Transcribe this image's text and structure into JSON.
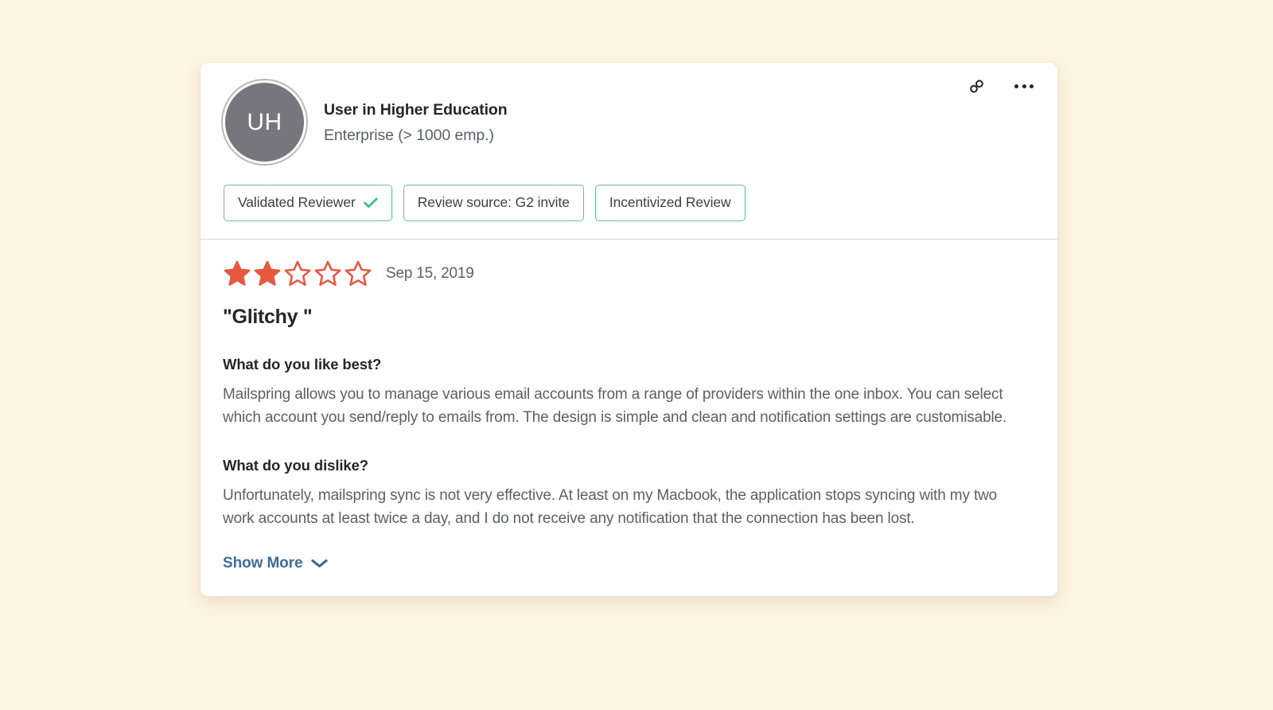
{
  "theme": {
    "page_background": "#fdf4e1",
    "card_background": "#ffffff",
    "badge_border": "#62c29a",
    "star_filled": "#e8573f",
    "star_empty_outline": "#e8573f",
    "link_color": "#3d6d95",
    "avatar_background": "#76767c",
    "check_color": "#3fc28a",
    "divider": "#d6d6d8"
  },
  "review": {
    "reviewer": {
      "avatar_initials": "UH",
      "name": "User in Higher Education",
      "company_size": "Enterprise (> 1000 emp.)"
    },
    "header_actions": {
      "share_link_label": "link-icon",
      "more_options_label": "..."
    },
    "badges": [
      {
        "label": "Validated Reviewer",
        "has_check": true
      },
      {
        "label": "Review source: G2 invite",
        "has_check": false
      },
      {
        "label": "Incentivized Review",
        "has_check": false
      }
    ],
    "rating": {
      "value": 2,
      "max": 5,
      "date": "Sep 15, 2019"
    },
    "title": "\"Glitchy \"",
    "sections": [
      {
        "question": "What do you like best?",
        "answer": "Mailspring allows you to manage various email accounts from a range of providers within the one inbox. You can select which account you send/reply to emails from. The design is simple and clean and notification settings are customisable."
      },
      {
        "question": "What do you dislike?",
        "answer": "Unfortunately, mailspring sync is not very effective. At least on my Macbook, the application stops syncing with my two work accounts at least twice a day, and I do not receive any notification that the connection has been lost."
      }
    ],
    "show_more_label": "Show More"
  }
}
